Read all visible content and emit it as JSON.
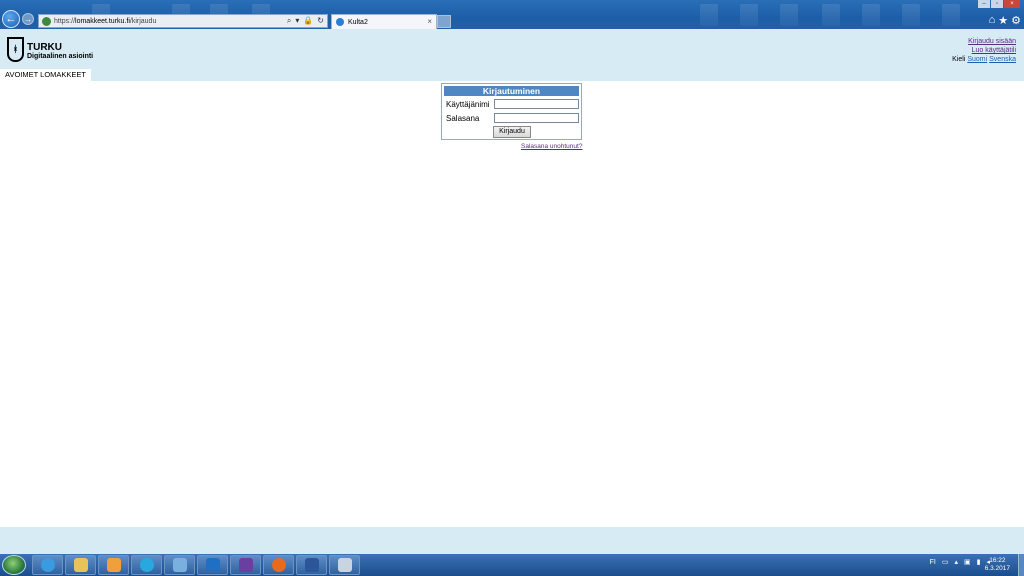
{
  "browser": {
    "url_prefix": "https://",
    "url_domain": "lomakkeet.turku.fi",
    "url_path": "/kirjaudu",
    "tab_title": "Kulta2",
    "tab_close": "×",
    "address_tools": [
      "⌕",
      "▾",
      "🔒",
      "↻"
    ],
    "right_buttons": [
      "⌂",
      "★",
      "⚙"
    ]
  },
  "header": {
    "logo_mark": "ᚼ",
    "brand_name": "TURKU",
    "brand_sub": "Digitaalinen asiointi",
    "login_link": "Kirjaudu sisään",
    "register_link": "Luo käyttäjätili",
    "language_label": "Kieli",
    "lang_fi": "Suomi",
    "lang_sv": "Svenska",
    "menu_tab": "AVOIMET LOMAKKEET"
  },
  "login": {
    "title": "Kirjautuminen",
    "username_label": "Käyttäjänimi",
    "username_value": "",
    "password_label": "Salasana",
    "password_value": "",
    "submit_label": "Kirjaudu",
    "forgot_link": "Salasana unohtunut?"
  },
  "taskbar": {
    "items": [
      "internet-explorer-icon",
      "file-explorer-icon",
      "media-player-icon",
      "skype-icon",
      "support-tool-icon",
      "outlook-icon",
      "contacts-icon",
      "firefox-icon",
      "word-icon",
      "paint-icon"
    ],
    "tray_lang": "FI",
    "time": "16:22",
    "date": "6.3.2017"
  },
  "colors": {
    "header_bg": "#d7ebf4",
    "login_title_bg": "#4f87c4",
    "visited_link": "#5a2d82",
    "link": "#1f5fb3"
  }
}
